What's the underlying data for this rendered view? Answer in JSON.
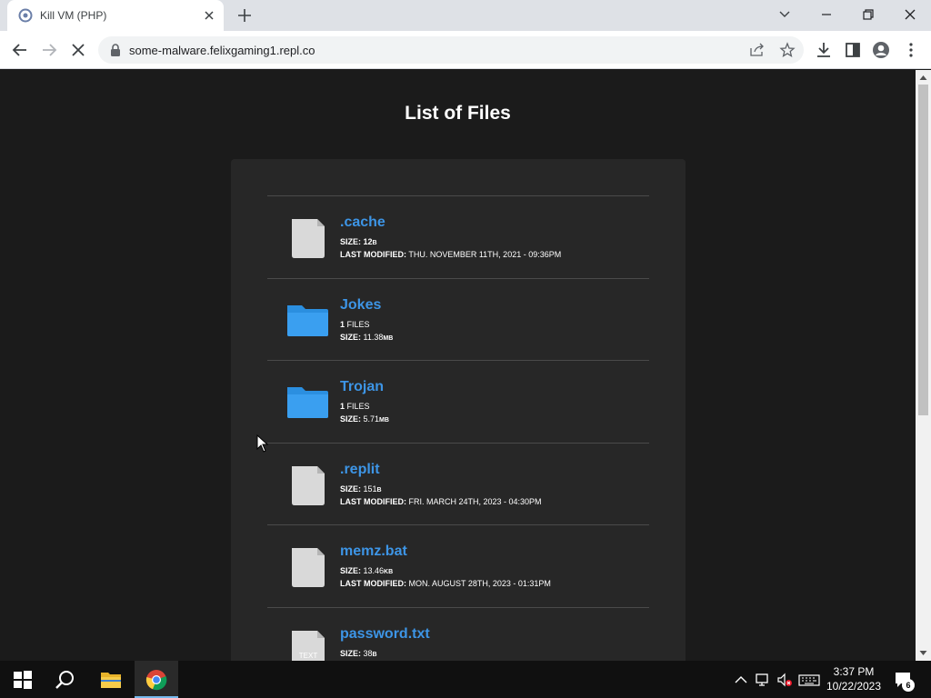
{
  "browser": {
    "tab_title": "Kill VM (PHP)",
    "url": "some-malware.felixgaming1.repl.co"
  },
  "page": {
    "title": "List of Files",
    "files": [
      {
        "name": ".cache",
        "type": "file",
        "size_label": "SIZE:",
        "size_value": " 12",
        "size_unit": "B",
        "line2_label": "LAST MODIFIED:",
        "line2_value": " THU. NOVEMBER 11TH, 2021 - 09:36PM"
      },
      {
        "name": "Jokes",
        "type": "folder",
        "count_value": "1",
        "count_label": " FILES",
        "size_label": "SIZE:",
        "size_value": " 11.38",
        "size_unit": "MB"
      },
      {
        "name": "Trojan",
        "type": "folder",
        "count_value": "1",
        "count_label": " FILES",
        "size_label": "SIZE:",
        "size_value": " 5.71",
        "size_unit": "MB"
      },
      {
        "name": ".replit",
        "type": "file",
        "size_label": "SIZE:",
        "size_value": " 151",
        "size_unit": "B",
        "line2_label": "LAST MODIFIED:",
        "line2_value": " FRI. MARCH 24TH, 2023 - 04:30PM"
      },
      {
        "name": "memz.bat",
        "type": "file",
        "size_label": "SIZE:",
        "size_value": " 13.46",
        "size_unit": "KB",
        "line2_label": "LAST MODIFIED:",
        "line2_value": " MON. AUGUST 28TH, 2023 - 01:31PM"
      },
      {
        "name": "password.txt",
        "type": "text",
        "icon_text": "TEXT",
        "size_label": "SIZE:",
        "size_value": " 38",
        "size_unit": "B"
      }
    ]
  },
  "taskbar": {
    "time": "3:37 PM",
    "date": "10/22/2023",
    "notification_count": "6"
  },
  "colors": {
    "link": "#3d95e6",
    "folder": "#2b8fe0",
    "page_bg": "#1b1b1b",
    "panel_bg": "#272727"
  }
}
